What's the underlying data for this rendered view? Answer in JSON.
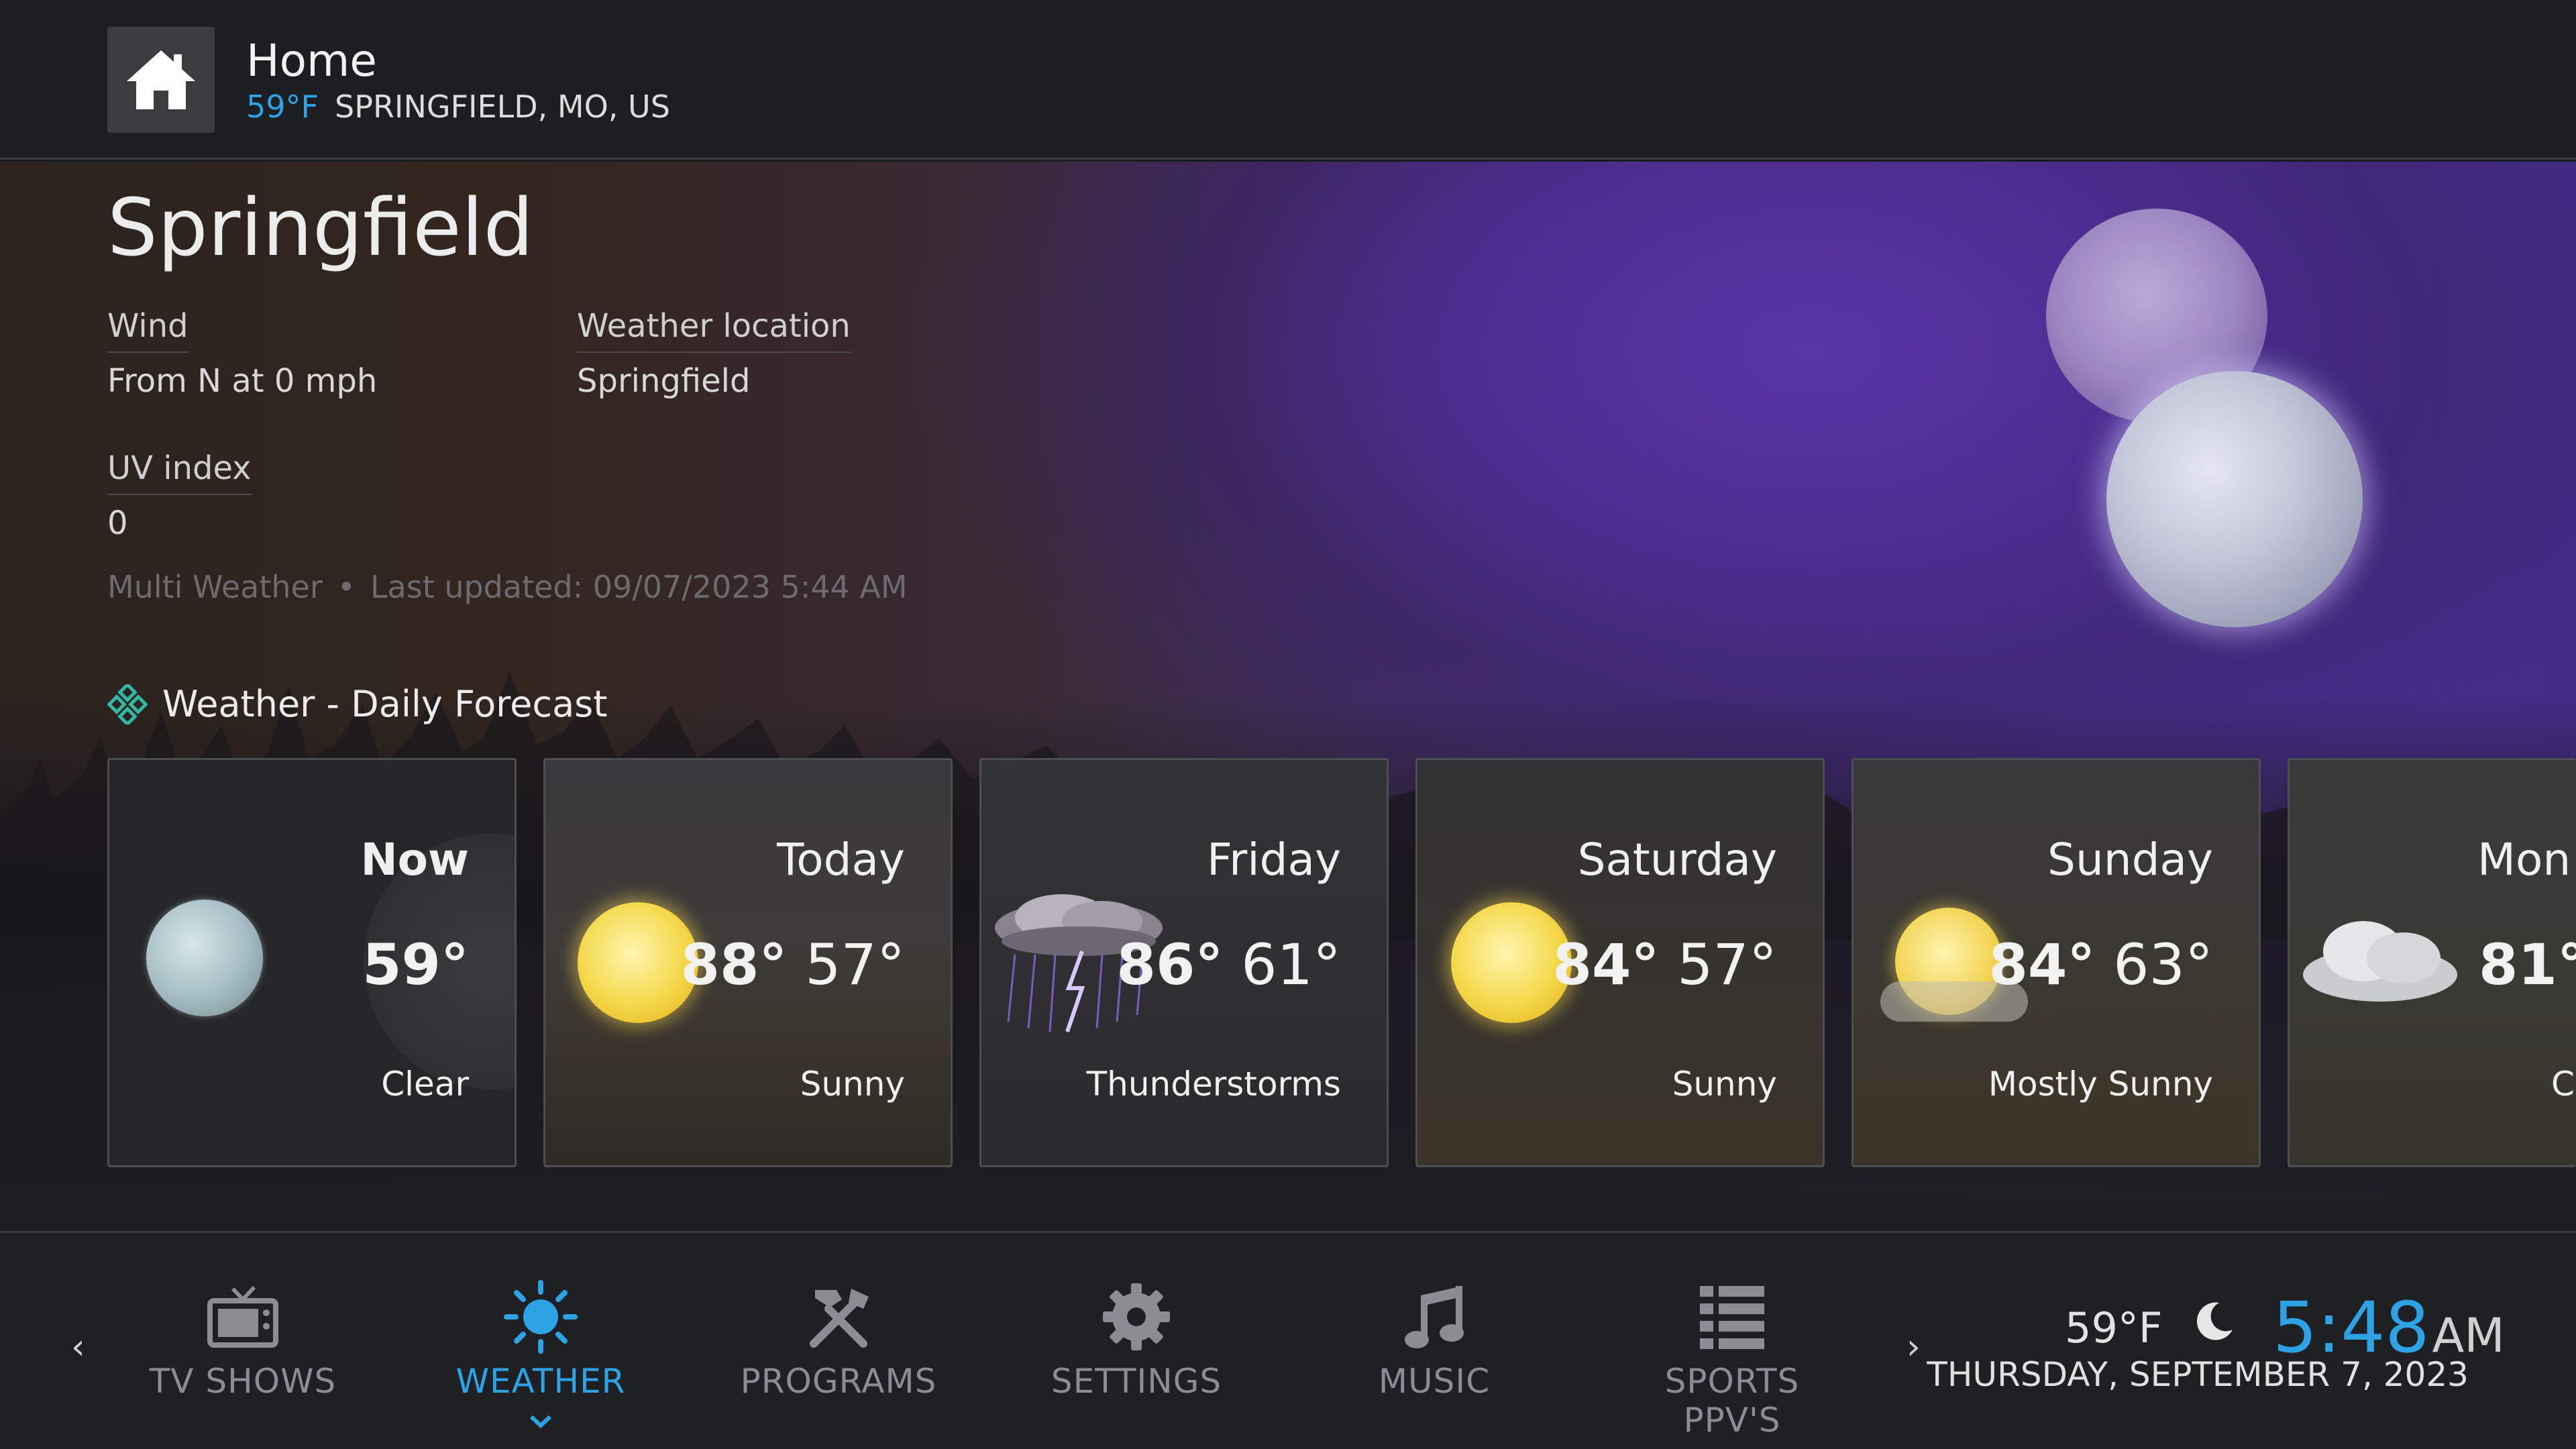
{
  "header": {
    "title": "Home",
    "temperature": "59°F",
    "location": "SPRINGFIELD, MO, US"
  },
  "weather": {
    "city": "Springfield",
    "wind_label": "Wind",
    "wind_value": "From N at 0 mph",
    "location_label": "Weather location",
    "location_value": "Springfield",
    "uv_label": "UV index",
    "uv_value": "0",
    "provider": "Multi Weather",
    "separator": "•",
    "last_updated": "Last updated: 09/07/2023 5:44 AM"
  },
  "forecast": {
    "section_title": "Weather - Daily Forecast",
    "cards": [
      {
        "day": "Now",
        "high": "59°",
        "low": "",
        "condition": "Clear",
        "icon": "moon-icon"
      },
      {
        "day": "Today",
        "high": "88°",
        "low": "57°",
        "condition": "Sunny",
        "icon": "sun-icon"
      },
      {
        "day": "Friday",
        "high": "86°",
        "low": "61°",
        "condition": "Thunderstorms",
        "icon": "thunderstorm-icon"
      },
      {
        "day": "Saturday",
        "high": "84°",
        "low": "57°",
        "condition": "Sunny",
        "icon": "sun-icon"
      },
      {
        "day": "Sunday",
        "high": "84°",
        "low": "63°",
        "condition": "Mostly Sunny",
        "icon": "partly-sunny-icon"
      },
      {
        "day": "Mon",
        "high": "81°",
        "low": "",
        "condition": "Cl",
        "icon": "cloud-icon"
      }
    ]
  },
  "nav": {
    "items": [
      {
        "label": "TV SHOWS",
        "icon": "tv-icon"
      },
      {
        "label": "WEATHER",
        "icon": "sun-icon",
        "active": true
      },
      {
        "label": "PROGRAMS",
        "icon": "tools-icon"
      },
      {
        "label": "SETTINGS",
        "icon": "gear-icon"
      },
      {
        "label": "MUSIC",
        "icon": "music-note-icon"
      },
      {
        "label": "SPORTS PPV'S",
        "icon": "list-icon"
      }
    ],
    "prev_arrow": "‹",
    "next_arrow": "›"
  },
  "status": {
    "temperature": "59°F",
    "time": "5:48",
    "ampm": "AM",
    "date": "THURSDAY, SEPTEMBER 7, 2023"
  },
  "colors": {
    "accent": "#2da3e6",
    "background": "#1b1c1e",
    "hero_purple": "#4c2d8f"
  }
}
